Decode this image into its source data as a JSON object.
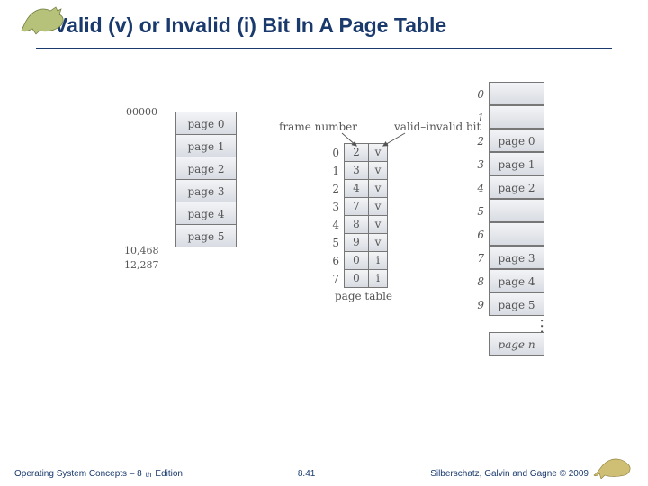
{
  "title": "Valid (v) or Invalid (i) Bit In A Page Table",
  "footer": {
    "left_prefix": "Operating System Concepts – 8",
    "left_sup": "th",
    "left_suffix": " Edition",
    "center": "8.41",
    "right": "Silberschatz, Galvin and Gagne © 2009"
  },
  "diag": {
    "addr_start": "00000",
    "addr_a": "10,468",
    "addr_b": "12,287",
    "labels": {
      "frame_number": "frame number",
      "valid_bit": "valid–invalid bit",
      "page_table": "page table"
    },
    "logical_pages": [
      "page 0",
      "page 1",
      "page 2",
      "page 3",
      "page 4",
      "page 5"
    ],
    "page_table": [
      {
        "i": "0",
        "f": "2",
        "v": "v"
      },
      {
        "i": "1",
        "f": "3",
        "v": "v"
      },
      {
        "i": "2",
        "f": "4",
        "v": "v"
      },
      {
        "i": "3",
        "f": "7",
        "v": "v"
      },
      {
        "i": "4",
        "f": "8",
        "v": "v"
      },
      {
        "i": "5",
        "f": "9",
        "v": "v"
      },
      {
        "i": "6",
        "f": "0",
        "v": "i"
      },
      {
        "i": "7",
        "f": "0",
        "v": "i"
      }
    ],
    "memory": [
      {
        "i": "0",
        "c": ""
      },
      {
        "i": "1",
        "c": ""
      },
      {
        "i": "2",
        "c": "page 0"
      },
      {
        "i": "3",
        "c": "page 1"
      },
      {
        "i": "4",
        "c": "page 2"
      },
      {
        "i": "5",
        "c": ""
      },
      {
        "i": "6",
        "c": ""
      },
      {
        "i": "7",
        "c": "page 3"
      },
      {
        "i": "8",
        "c": "page 4"
      },
      {
        "i": "9",
        "c": "page 5"
      }
    ],
    "memory_last": "page n",
    "memory_last_idx": ""
  }
}
